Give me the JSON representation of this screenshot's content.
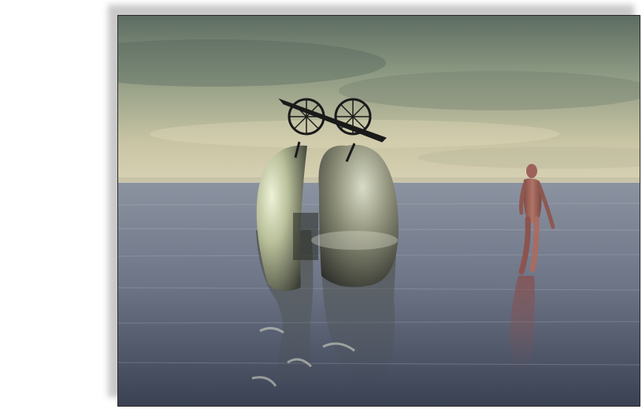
{
  "image": {
    "subject": "surreal-3d-render",
    "colors": {
      "sky_top": "#5f6e63",
      "sky_mid": "#a6ae92",
      "sky_horizon": "#d9d4b2",
      "water_far": "#8b95a0",
      "water_near": "#3f4657",
      "egg_highlight": "#e6ecd0",
      "egg_dark": "#3a3d35",
      "figure": "#a0665e",
      "cannon": "#1c1c1c"
    }
  }
}
